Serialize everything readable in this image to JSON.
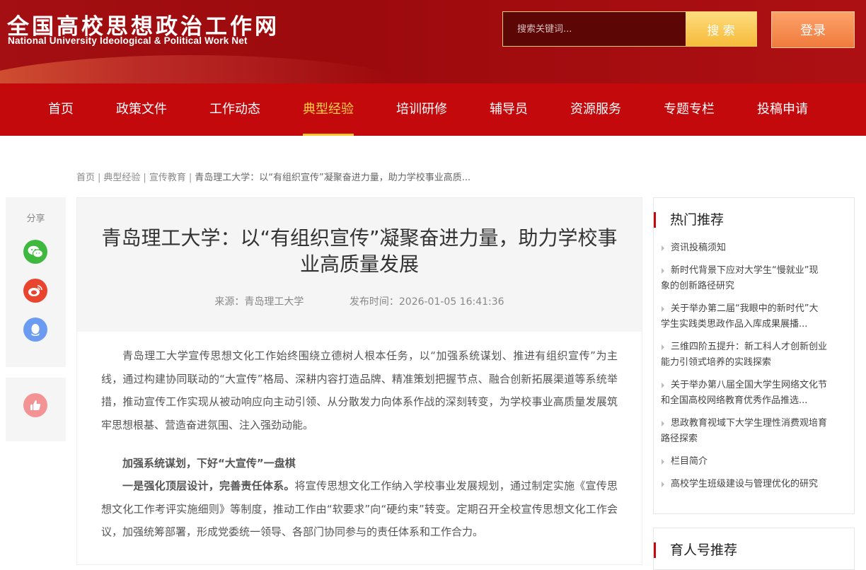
{
  "header": {
    "logo_cn": "全国高校思想政治工作网",
    "logo_en": "National University Ideological & Political Work Net",
    "search_placeholder": "搜索关键词...",
    "search_button": "搜 索",
    "login_button": "登录"
  },
  "nav": {
    "items": [
      {
        "label": "首页"
      },
      {
        "label": "政策文件"
      },
      {
        "label": "工作动态"
      },
      {
        "label": "典型经验"
      },
      {
        "label": "培训研修"
      },
      {
        "label": "辅导员"
      },
      {
        "label": "资源服务"
      },
      {
        "label": "专题专栏"
      },
      {
        "label": "投稿申请"
      }
    ],
    "active": "典型经验"
  },
  "breadcrumb": {
    "items": [
      "首页",
      "典型经验",
      "宣传教育"
    ],
    "current": "青岛理工大学：以“有组织宣传”凝聚奋进力量，助力学校事业高质..."
  },
  "share": {
    "label": "分享",
    "icons": [
      "wechat-icon",
      "weibo-icon",
      "qq-icon"
    ],
    "like_icon": "thumbs-up-icon"
  },
  "article": {
    "title_line1": "青岛理工大学：以“有组织宣传”凝聚奋进力量，助力学校事",
    "title_line2": "业高质量发展",
    "source": "来源：青岛理工大学",
    "publish_time": "发布时间：2026-01-05 16:41:36",
    "para1": "青岛理工大学宣传思想文化工作始终围绕立德树人根本任务，以“加强系统谋划、推进有组织宣传”为主线，通过构建协同联动的“大宣传”格局、深耕内容打造品牌、精准策划把握节点、融合创新拓展渠道等系统举措，推动宣传工作实现从被动响应向主动引领、从分散发力向体系作战的深刻转变，为学校事业高质量发展筑牢思想根基、营造奋进氛围、注入强劲动能。",
    "subhead1": "加强系统谋划，下好“大宣传”一盘棋",
    "para2_bold": "一是强化顶层设计，完善责任体系。",
    "para2_rest": "将宣传思想文化工作纳入学校事业发展规划，通过制定实施《宣传思想文化工作考评实施细则》等制度，推动工作由“软要求”向“硬约束”转变。定期召开全校宣传思想文化工作会议，加强统筹部署，形成党委统一领导、各部门协同参与的责任体系和工作合力。"
  },
  "sidebar": {
    "hot_title": "热门推荐",
    "hot_items": [
      {
        "line1": "资讯投稿须知",
        "line2": ""
      },
      {
        "line1": "新时代背景下应对大学生“慢就业”现",
        "line2": "象的创新路径研究"
      },
      {
        "line1": "关于举办第二届“我眼中的新时代”大",
        "line2": "学生实践类思政作品入库成果展播..."
      },
      {
        "line1": "三维四阶五提升：新工科人才创新创业",
        "line2": "能力引领式培养的实践探索"
      },
      {
        "line1": "关于举办第八届全国大学生网络文化节",
        "line2": "和全国高校网络教育优秀作品推选..."
      },
      {
        "line1": "思政教育视域下大学生理性消费观培育",
        "line2": "路径探索"
      },
      {
        "line1": "栏目简介",
        "line2": ""
      },
      {
        "line1": "高校学生班级建设与管理优化的研究",
        "line2": ""
      }
    ],
    "second_title": "育人号推荐"
  },
  "colors": {
    "brand_red": "#c4090d",
    "header_red": "#a30f12",
    "nav_active": "#ffd043",
    "search_button": "#f9c94c",
    "login_button": "#f48c4f"
  }
}
